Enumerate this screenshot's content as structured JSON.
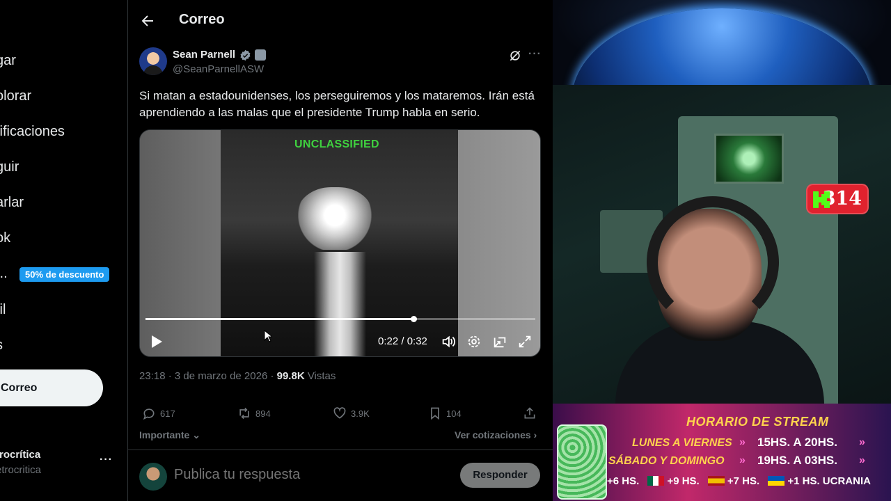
{
  "nav": {
    "items": [
      "gar",
      "olorar",
      "tificaciones",
      "guir",
      "arlar",
      "ok",
      "...",
      "fil",
      "s"
    ],
    "promo": "50% de descuento",
    "post_button": "Correo",
    "account_name": "trocrítica",
    "account_handle": "etrocritica",
    "more": "···"
  },
  "header": {
    "title": "Correo"
  },
  "tweet": {
    "author": "Sean Parnell",
    "handle": "@SeanParnellASW",
    "text": "Si matan a estadounidenses, los perseguiremos y los mataremos. Irán está aprendiendo a las malas que el presidente Trump habla en serio.",
    "video": {
      "label": "UNCLASSIFIED",
      "time": "0:22 / 0:32",
      "progress": 0.6875
    },
    "time": "23:18 · 3 de marzo de 2026 · ",
    "views_count": "99.8K",
    "views_label": " Vistas",
    "replies": "617",
    "reposts": "894",
    "likes": "3.9K",
    "bookmarks": "104",
    "sort": "Importante",
    "quotes": "Ver cotizaciones"
  },
  "reply": {
    "placeholder": "Publica tu respuesta",
    "button": "Responder"
  },
  "stream": {
    "badge": "314",
    "schedule_title": "HORARIO DE STREAM",
    "row1_days": "LUNES A VIERNES",
    "row1_time": "15HS. A 20HS.",
    "row2_days": "SÁBADO Y DOMINGO",
    "row2_time": "19HS. A 03HS.",
    "tz1": "+6 HS.",
    "tz2": "+9 HS.",
    "tz3": "+7 HS.",
    "tz4": "+1 HS. UCRANIA"
  },
  "colors": {
    "accent": "#1d9bf0",
    "badge": "#e0222e",
    "schedule_text": "#ffd34d",
    "video_label": "#3fd13f"
  }
}
